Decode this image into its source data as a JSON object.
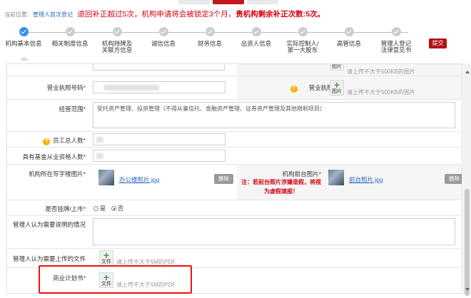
{
  "notice": {
    "crumb": "当前位置：",
    "crumb_link": "管理人首次登记",
    "warning_prefix": "退回补正超过5次，机构申请将会被锁定3个月，",
    "warning_bold": "贵机构剩余补正次数:5次。"
  },
  "steps": [
    {
      "label": "机构基本信息"
    },
    {
      "label": "相关制度信息"
    },
    {
      "label": "机构持牌及关联方信息"
    },
    {
      "label": "诚信信息"
    },
    {
      "label": "财务信息"
    },
    {
      "label": "出资人信息"
    },
    {
      "label": "实际控制人/第一大股东"
    },
    {
      "label": "高管信息"
    },
    {
      "label": "管理人登记法律意见书"
    }
  ],
  "submit_label": "提交",
  "upload": {
    "image_tag": "图片",
    "file_tag": "文件",
    "image_hint": "请上传不大于500KB的图片",
    "pdf_hint": "请上传不大于5M的PDF"
  },
  "form": {
    "license_code_label": "营业执照号码",
    "license_label": "营业执照",
    "scope_label": "经营范围",
    "scope_value": "受托资产管理、投资管理（不得从事信托、金融资产管理、证券资产管理及其他限制项目）",
    "employees_label": "员工总人数",
    "fund_staff_label": "具有基金从业资格人数",
    "office_photo_label": "机构所在写字楼图片",
    "office_photo_file": "办公楼照片.jpg",
    "front_photo_label": "机构前台图片",
    "front_photo_file": "前台照片.jpg",
    "front_warning": "注：若前台照片涉嫌造假，将视为虚假填报！",
    "delete_label": "删除",
    "listed_label": "是否挂牌/上市",
    "listed_yes": "是",
    "listed_no": "否",
    "explain_label": "管理人认为需要说明的情况",
    "upload_files_label": "管理人认为需要上传的文件",
    "business_plan_label": "商业计划书"
  },
  "colors": {
    "brand_red": "#c6161d",
    "warning_red": "#d7000f",
    "active_step": "#3b8ee8",
    "link_blue": "#2a6ab8"
  }
}
